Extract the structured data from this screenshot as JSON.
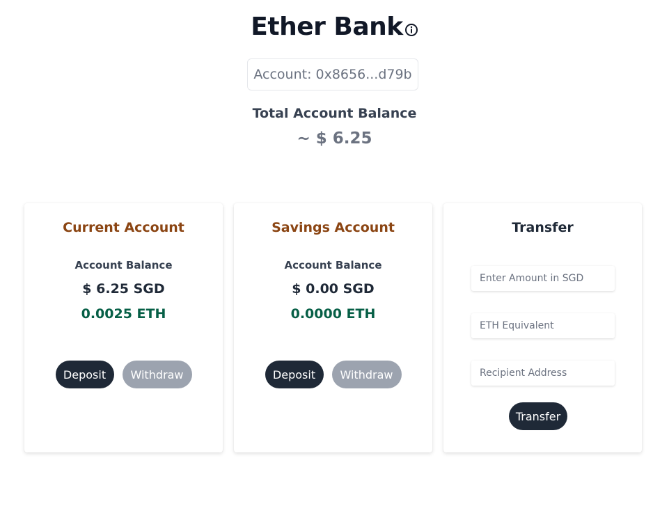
{
  "header": {
    "title": "Ether Bank",
    "info_icon": "info-circle-icon",
    "account": "Account: 0x8656...d79b",
    "total_label": "Total Account Balance",
    "total_value": "~ $ 6.25"
  },
  "colors": {
    "card_title_brown": "#8b4513",
    "eth_green": "#065f46",
    "button_dark": "#1f2937",
    "button_gray": "#9ca3af"
  },
  "current": {
    "title": "Current Account",
    "balance_label": "Account Balance",
    "sgd": "$ 6.25 SGD",
    "eth": "0.0025 ETH",
    "deposit": "Deposit",
    "withdraw": "Withdraw"
  },
  "savings": {
    "title": "Savings Account",
    "balance_label": "Account Balance",
    "sgd": "$ 0.00 SGD",
    "eth": "0.0000 ETH",
    "deposit": "Deposit",
    "withdraw": "Withdraw"
  },
  "transfer": {
    "title": "Transfer",
    "amount_placeholder": "Enter Amount in SGD",
    "eth_placeholder": "ETH Equivalent",
    "recipient_placeholder": "Recipient Address",
    "button": "Transfer"
  }
}
